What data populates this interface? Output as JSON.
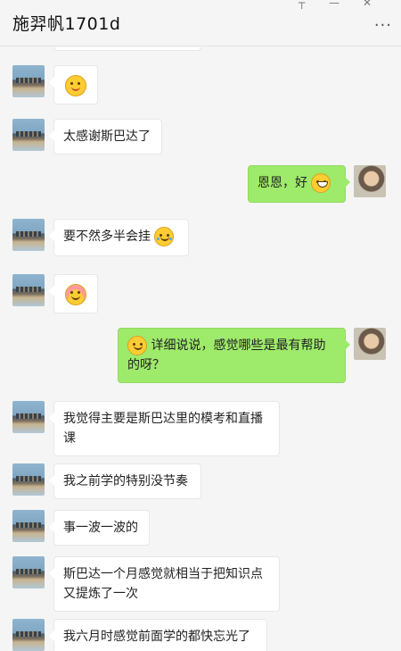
{
  "header": {
    "title": "施羿帆1701d",
    "more_label": "...",
    "pin_icon": "pin-icon",
    "minimize_icon": "minimize-icon",
    "close_icon": "close-icon"
  },
  "messages": [
    {
      "side": "left",
      "type": "emoji",
      "emoji": "grimace-face"
    },
    {
      "side": "left",
      "type": "text",
      "text": "太感谢斯巴达了"
    },
    {
      "side": "right",
      "type": "text",
      "text": "恩恩，好",
      "emoji_after": "grin-face"
    },
    {
      "side": "left",
      "type": "text",
      "text": "要不然多半会挂",
      "emoji_after": "tears-face"
    },
    {
      "side": "left",
      "type": "emoji",
      "emoji": "shy-face"
    },
    {
      "side": "right",
      "type": "text",
      "text": "详细说说，感觉哪些是最有帮助的呀？",
      "emoji_before": "smile-face"
    },
    {
      "side": "left",
      "type": "text",
      "text": "我觉得主要是斯巴达里的模考和直播课"
    },
    {
      "side": "left",
      "type": "text",
      "text": "我之前学的特别没节奏"
    },
    {
      "side": "left",
      "type": "text",
      "text": "事一波一波的"
    },
    {
      "side": "left",
      "type": "text",
      "text": "斯巴达一个月感觉就相当于把知识点又提炼了一次"
    },
    {
      "side": "left",
      "type": "text",
      "text": "我六月时感觉前面学的都快忘光了"
    }
  ],
  "colors": {
    "background": "#f5f5f5",
    "bubble_self": "#9eea6a",
    "bubble_other": "#ffffff"
  }
}
